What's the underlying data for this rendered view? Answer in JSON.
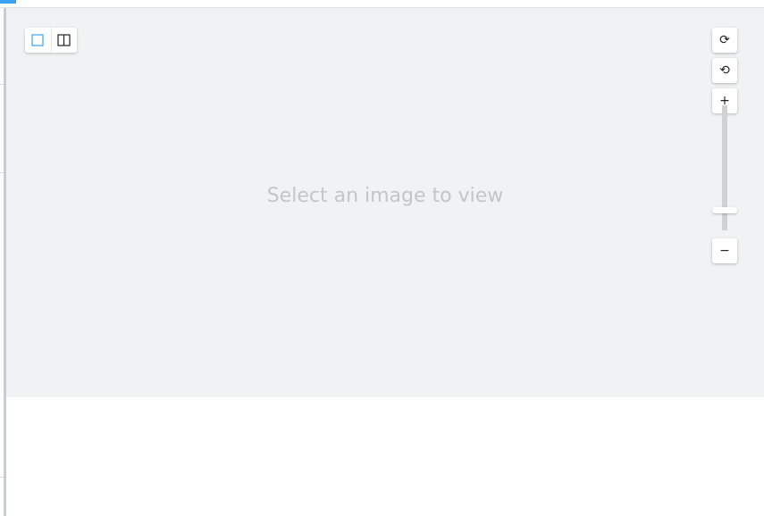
{
  "viewer": {
    "placeholder": "Select an image to view",
    "background": "#eff3f4"
  },
  "view_toggle": {
    "buttons": [
      {
        "icon": "single-view-icon",
        "active": true
      },
      {
        "icon": "split-view-icon",
        "active": false
      }
    ],
    "accent": "#3aa3f5"
  },
  "controls": {
    "rotate_cw": {
      "icon": "rotate-clockwise-icon",
      "glyph": "⟳"
    },
    "rotate_ccw": {
      "icon": "rotate-counterclockwise-icon",
      "glyph": "⟲"
    },
    "zoom_in": {
      "icon": "zoom-in-icon",
      "glyph": "+"
    },
    "zoom_out": {
      "icon": "zoom-out-icon",
      "glyph": "−"
    },
    "zoom_level": 0.1
  }
}
